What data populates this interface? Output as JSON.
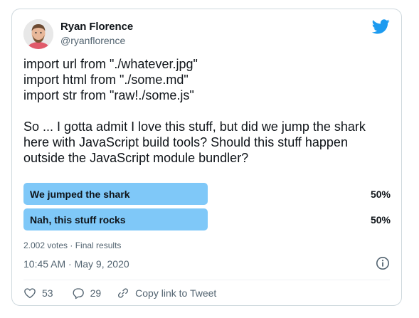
{
  "author": {
    "name": "Ryan Florence",
    "handle": "@ryanflorence"
  },
  "tweet": {
    "lines": [
      "import url from \"./whatever.jpg\"",
      "import html from \"./some.md\"",
      "import str from \"raw!./some.js\"",
      "So ... I gotta admit I love this stuff, but did we jump the shark",
      "here with JavaScript build tools? Should this stuff happen",
      "outside the JavaScript module bundler?"
    ]
  },
  "poll": {
    "options": [
      {
        "label": "We jumped the shark",
        "percent": "50%",
        "fill": 0.5
      },
      {
        "label": "Nah, this stuff rocks",
        "percent": "50%",
        "fill": 0.5
      }
    ],
    "summary": "2.002 votes · Final results",
    "bar_color": "#7fc8f8"
  },
  "timestamp": "10:45 AM · May 9, 2020",
  "actions": {
    "likes": "53",
    "replies": "29",
    "copy_link": "Copy link to Tweet"
  },
  "colors": {
    "twitter_blue": "#1d9bf0",
    "text_primary": "#0f1419",
    "text_secondary": "#536471",
    "border": "#cfd9de"
  },
  "icons": [
    "avatar",
    "twitter-bird-icon",
    "info-icon",
    "heart-icon",
    "reply-icon",
    "link-icon"
  ]
}
